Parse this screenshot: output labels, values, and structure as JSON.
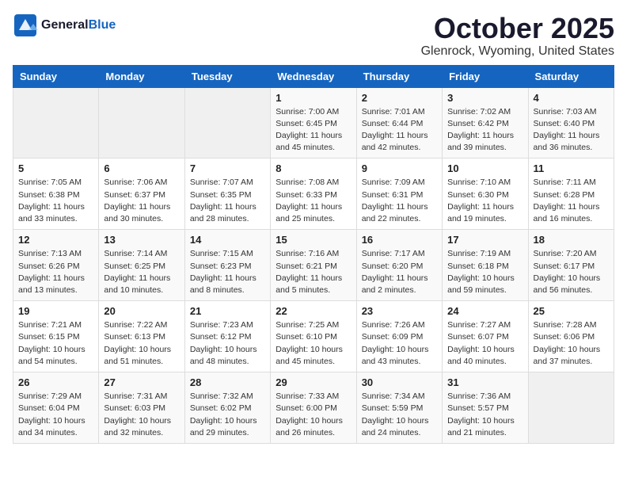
{
  "header": {
    "logo_general": "General",
    "logo_blue": "Blue",
    "month_title": "October 2025",
    "location": "Glenrock, Wyoming, United States"
  },
  "weekdays": [
    "Sunday",
    "Monday",
    "Tuesday",
    "Wednesday",
    "Thursday",
    "Friday",
    "Saturday"
  ],
  "weeks": [
    [
      {
        "day": "",
        "sunrise": "",
        "sunset": "",
        "daylight": ""
      },
      {
        "day": "",
        "sunrise": "",
        "sunset": "",
        "daylight": ""
      },
      {
        "day": "",
        "sunrise": "",
        "sunset": "",
        "daylight": ""
      },
      {
        "day": "1",
        "sunrise": "7:00 AM",
        "sunset": "6:45 PM",
        "daylight": "11 hours and 45 minutes."
      },
      {
        "day": "2",
        "sunrise": "7:01 AM",
        "sunset": "6:44 PM",
        "daylight": "11 hours and 42 minutes."
      },
      {
        "day": "3",
        "sunrise": "7:02 AM",
        "sunset": "6:42 PM",
        "daylight": "11 hours and 39 minutes."
      },
      {
        "day": "4",
        "sunrise": "7:03 AM",
        "sunset": "6:40 PM",
        "daylight": "11 hours and 36 minutes."
      }
    ],
    [
      {
        "day": "5",
        "sunrise": "7:05 AM",
        "sunset": "6:38 PM",
        "daylight": "11 hours and 33 minutes."
      },
      {
        "day": "6",
        "sunrise": "7:06 AM",
        "sunset": "6:37 PM",
        "daylight": "11 hours and 30 minutes."
      },
      {
        "day": "7",
        "sunrise": "7:07 AM",
        "sunset": "6:35 PM",
        "daylight": "11 hours and 28 minutes."
      },
      {
        "day": "8",
        "sunrise": "7:08 AM",
        "sunset": "6:33 PM",
        "daylight": "11 hours and 25 minutes."
      },
      {
        "day": "9",
        "sunrise": "7:09 AM",
        "sunset": "6:31 PM",
        "daylight": "11 hours and 22 minutes."
      },
      {
        "day": "10",
        "sunrise": "7:10 AM",
        "sunset": "6:30 PM",
        "daylight": "11 hours and 19 minutes."
      },
      {
        "day": "11",
        "sunrise": "7:11 AM",
        "sunset": "6:28 PM",
        "daylight": "11 hours and 16 minutes."
      }
    ],
    [
      {
        "day": "12",
        "sunrise": "7:13 AM",
        "sunset": "6:26 PM",
        "daylight": "11 hours and 13 minutes."
      },
      {
        "day": "13",
        "sunrise": "7:14 AM",
        "sunset": "6:25 PM",
        "daylight": "11 hours and 10 minutes."
      },
      {
        "day": "14",
        "sunrise": "7:15 AM",
        "sunset": "6:23 PM",
        "daylight": "11 hours and 8 minutes."
      },
      {
        "day": "15",
        "sunrise": "7:16 AM",
        "sunset": "6:21 PM",
        "daylight": "11 hours and 5 minutes."
      },
      {
        "day": "16",
        "sunrise": "7:17 AM",
        "sunset": "6:20 PM",
        "daylight": "11 hours and 2 minutes."
      },
      {
        "day": "17",
        "sunrise": "7:19 AM",
        "sunset": "6:18 PM",
        "daylight": "10 hours and 59 minutes."
      },
      {
        "day": "18",
        "sunrise": "7:20 AM",
        "sunset": "6:17 PM",
        "daylight": "10 hours and 56 minutes."
      }
    ],
    [
      {
        "day": "19",
        "sunrise": "7:21 AM",
        "sunset": "6:15 PM",
        "daylight": "10 hours and 54 minutes."
      },
      {
        "day": "20",
        "sunrise": "7:22 AM",
        "sunset": "6:13 PM",
        "daylight": "10 hours and 51 minutes."
      },
      {
        "day": "21",
        "sunrise": "7:23 AM",
        "sunset": "6:12 PM",
        "daylight": "10 hours and 48 minutes."
      },
      {
        "day": "22",
        "sunrise": "7:25 AM",
        "sunset": "6:10 PM",
        "daylight": "10 hours and 45 minutes."
      },
      {
        "day": "23",
        "sunrise": "7:26 AM",
        "sunset": "6:09 PM",
        "daylight": "10 hours and 43 minutes."
      },
      {
        "day": "24",
        "sunrise": "7:27 AM",
        "sunset": "6:07 PM",
        "daylight": "10 hours and 40 minutes."
      },
      {
        "day": "25",
        "sunrise": "7:28 AM",
        "sunset": "6:06 PM",
        "daylight": "10 hours and 37 minutes."
      }
    ],
    [
      {
        "day": "26",
        "sunrise": "7:29 AM",
        "sunset": "6:04 PM",
        "daylight": "10 hours and 34 minutes."
      },
      {
        "day": "27",
        "sunrise": "7:31 AM",
        "sunset": "6:03 PM",
        "daylight": "10 hours and 32 minutes."
      },
      {
        "day": "28",
        "sunrise": "7:32 AM",
        "sunset": "6:02 PM",
        "daylight": "10 hours and 29 minutes."
      },
      {
        "day": "29",
        "sunrise": "7:33 AM",
        "sunset": "6:00 PM",
        "daylight": "10 hours and 26 minutes."
      },
      {
        "day": "30",
        "sunrise": "7:34 AM",
        "sunset": "5:59 PM",
        "daylight": "10 hours and 24 minutes."
      },
      {
        "day": "31",
        "sunrise": "7:36 AM",
        "sunset": "5:57 PM",
        "daylight": "10 hours and 21 minutes."
      },
      {
        "day": "",
        "sunrise": "",
        "sunset": "",
        "daylight": ""
      }
    ]
  ],
  "labels": {
    "sunrise": "Sunrise:",
    "sunset": "Sunset:",
    "daylight": "Daylight:"
  }
}
